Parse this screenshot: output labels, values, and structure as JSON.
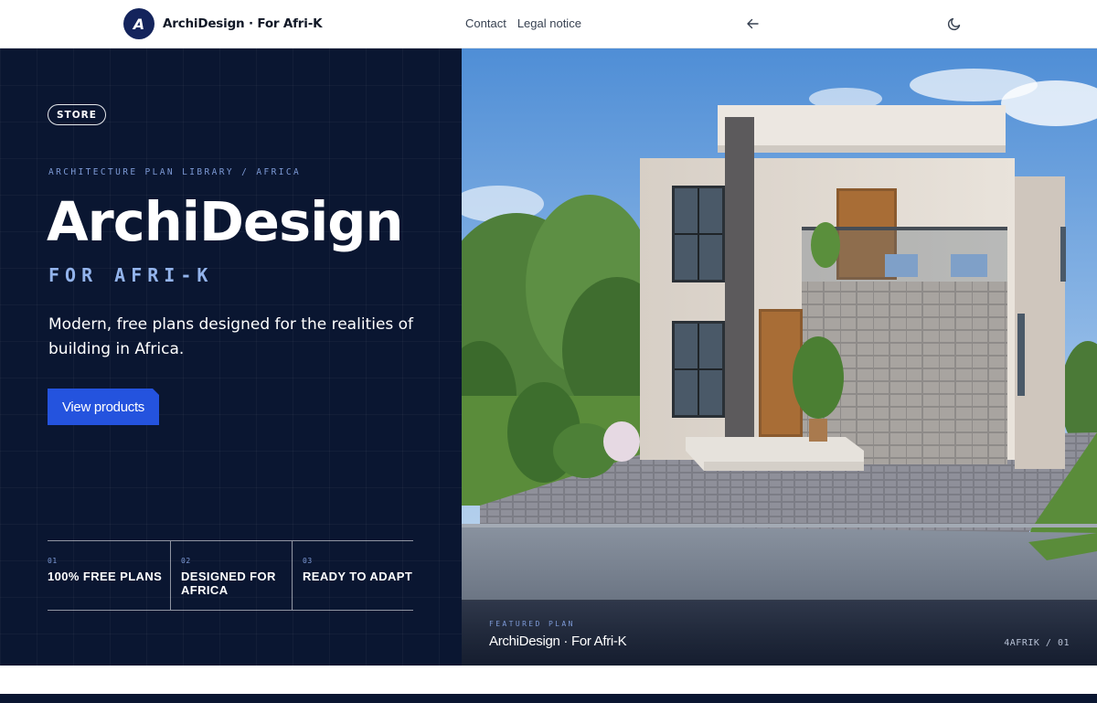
{
  "header": {
    "logo_letter": "A",
    "brand": "ArchiDesign · For Afri-K",
    "nav": [
      {
        "label": "Contact"
      },
      {
        "label": "Legal notice"
      }
    ],
    "back_icon": "arrow-left-icon",
    "theme_icon": "moon-icon"
  },
  "hero": {
    "badge": "STORE",
    "kicker": "ARCHITECTURE PLAN LIBRARY / AFRICA",
    "title": "ArchiDesign",
    "subtitle": "FOR AFRI-K",
    "description": "Modern, free plans designed for the realities of building in Africa.",
    "cta_label": "View products",
    "features": [
      {
        "num": "01",
        "text": "100% FREE PLANS"
      },
      {
        "num": "02",
        "text": "DESIGNED FOR AFRICA"
      },
      {
        "num": "03",
        "text": "READY TO ADAPT"
      }
    ]
  },
  "featured": {
    "label": "FEATURED PLAN",
    "name": "ArchiDesign · For Afri-K",
    "code": "4AFRIK / 01"
  },
  "colors": {
    "navy": "#0a1631",
    "accent_blue": "#2453de",
    "kicker_blue": "#7d9ad6",
    "logo_navy": "#14245c"
  }
}
